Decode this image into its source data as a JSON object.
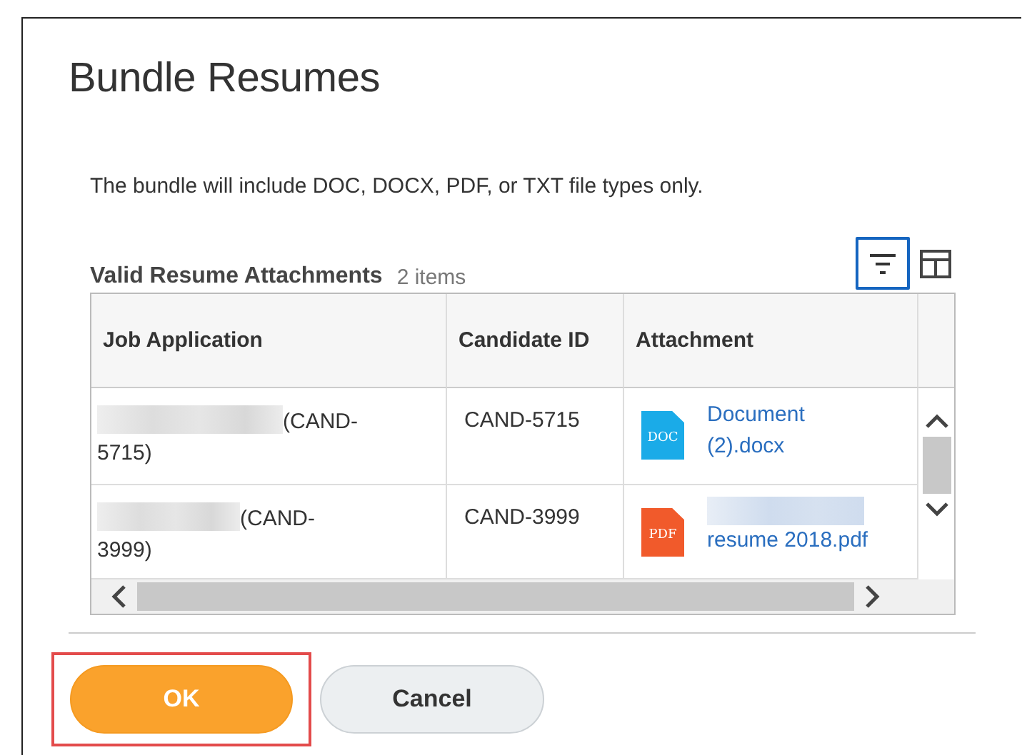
{
  "title": "Bundle Resumes",
  "description": "The bundle will include DOC, DOCX, PDF, or TXT file types only.",
  "section": {
    "title": "Valid Resume Attachments",
    "count": "2 items"
  },
  "toolbar": [
    {
      "kind": "filter",
      "selected": true
    },
    {
      "kind": "columns",
      "selected": false
    }
  ],
  "table": {
    "columns": [
      "Job Application",
      "Candidate ID",
      "Attachment"
    ],
    "rows": [
      {
        "job_application": "(CAND-5715)",
        "name_redacted": true,
        "candidate_id": "CAND-5715",
        "file_type": "DOC",
        "attachment": "Document (2).docx",
        "attachment_redacted": false
      },
      {
        "job_application": "(CAND-3999)",
        "name_redacted": true,
        "candidate_id": "CAND-3999",
        "file_type": "PDF",
        "attachment": "resume 2018.pdf",
        "attachment_redacted": true
      }
    ]
  },
  "buttons": [
    {
      "label": "OK",
      "kind": "primary",
      "highlighted": true
    },
    {
      "label": "Cancel",
      "kind": "secondary",
      "highlighted": false
    }
  ]
}
